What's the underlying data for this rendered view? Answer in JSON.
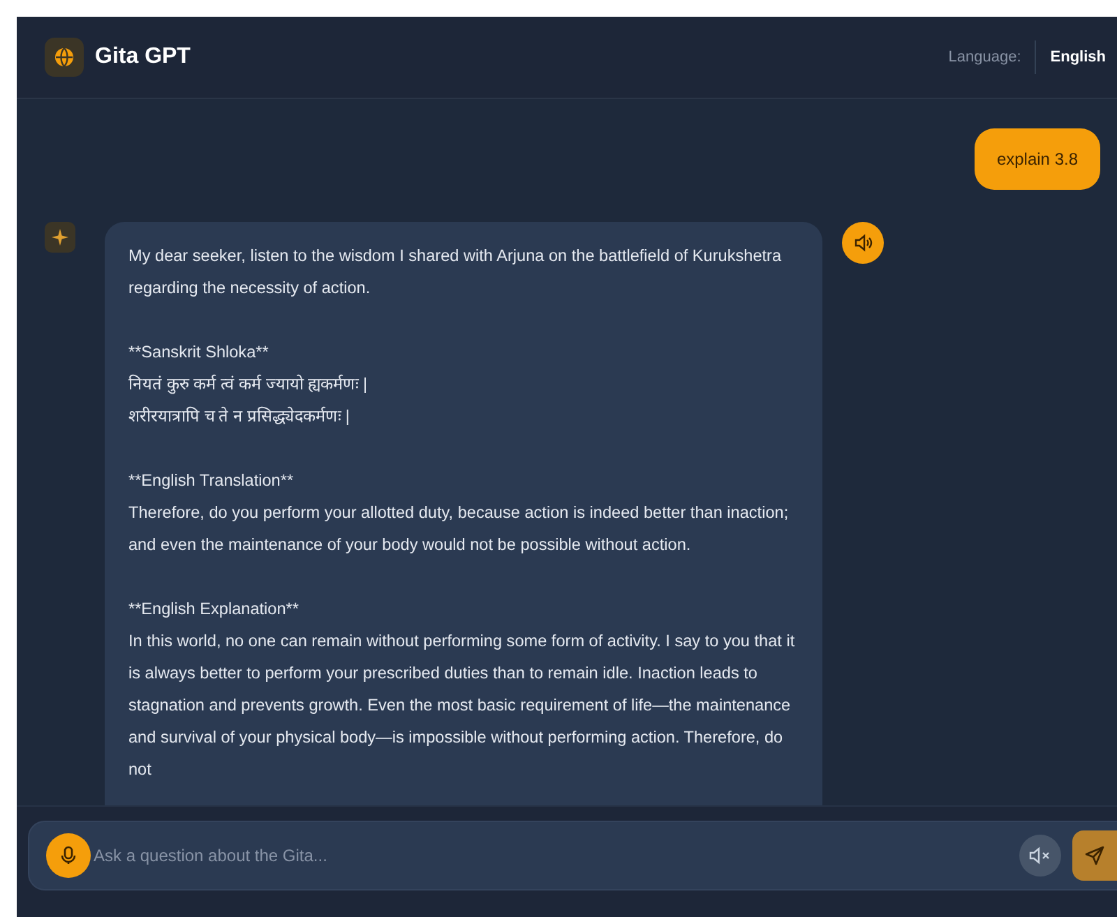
{
  "header": {
    "title": "Gita GPT",
    "language_label": "Language:",
    "language_value": "English"
  },
  "messages": [
    {
      "kind": "user",
      "text": "explain 3.8"
    },
    {
      "kind": "assistant",
      "paragraphs": [
        {
          "lines": [
            "My dear seeker, listen to the wisdom I shared with Arjuna on the battlefield of Kurukshetra regarding the necessity of action."
          ]
        },
        {
          "lines": [
            "**Sanskrit Shloka**",
            "नियतं कुरु कर्म त्वं कर्म ज्यायो ह्यकर्मणः |",
            "शरीरयात्रापि च ते न प्रसिद्ध्येदकर्मणः |"
          ]
        },
        {
          "lines": [
            "**English Translation**",
            "Therefore, do you perform your allotted duty, because action is indeed better than inaction; and even the maintenance of your body would not be possible without action."
          ]
        },
        {
          "lines": [
            "**English Explanation**",
            "In this world, no one can remain without performing some form of activity. I say to you that it is always better to perform your prescribed duties than to remain idle. Inaction leads to stagnation and prevents growth. Even the most basic requirement of life—the maintenance and survival of your physical body—is impossible without performing action. Therefore, do not"
          ]
        }
      ]
    }
  ],
  "input": {
    "placeholder": "Ask a question about the Gita...",
    "muted": true
  }
}
